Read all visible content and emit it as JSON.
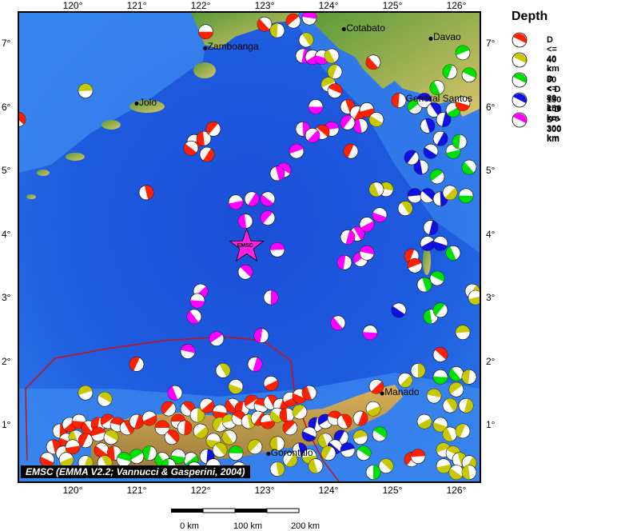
{
  "legend": {
    "title": "Depth",
    "items": [
      {
        "label": "D <= 40 km",
        "color": "#ff2000"
      },
      {
        "label": "40 < D <= 80 km",
        "color": "#c8c800"
      },
      {
        "label": "80 < D <= 150 km",
        "color": "#00e000"
      },
      {
        "label": "150 < D <= 300 km",
        "color": "#1010e0"
      },
      {
        "label": "D > 300 km",
        "color": "#ff00ff"
      }
    ]
  },
  "credit": "EMSC (EMMA V2.2; Vannucci & Gasperini, 2004)",
  "star_label": "EMSC",
  "scale": {
    "labels": [
      "0 km",
      "100 km",
      "200 km"
    ]
  },
  "axes": {
    "lon_labels": [
      "120°",
      "121°",
      "122°",
      "123°",
      "124°",
      "125°",
      "126°"
    ],
    "lat_labels": [
      "7°",
      "6°",
      "5°",
      "4°",
      "3°",
      "2°",
      "1°"
    ]
  },
  "cities": [
    {
      "name": "Zamboanga",
      "lon": 122.07,
      "lat": 6.92
    },
    {
      "name": "Cotabato",
      "lon": 124.24,
      "lat": 7.22
    },
    {
      "name": "Davao",
      "lon": 125.6,
      "lat": 7.07
    },
    {
      "name": "Jolo",
      "lon": 121.0,
      "lat": 6.05
    },
    {
      "name": "General Santos",
      "lon": 125.17,
      "lat": 6.11
    },
    {
      "name": "Manado",
      "lon": 124.84,
      "lat": 1.49
    },
    {
      "name": "Gorontalo",
      "lon": 123.06,
      "lat": 0.54
    }
  ],
  "epicenter": {
    "lon": 122.72,
    "lat": 3.8
  },
  "events": [
    {
      "lon": 122.08,
      "lat": 7.18,
      "d": 1
    },
    {
      "lon": 123.0,
      "lat": 7.3,
      "d": 1
    },
    {
      "lon": 123.2,
      "lat": 7.2,
      "d": 2
    },
    {
      "lon": 123.45,
      "lat": 7.35,
      "d": 1
    },
    {
      "lon": 123.7,
      "lat": 7.4,
      "d": 5
    },
    {
      "lon": 123.65,
      "lat": 7.05,
      "d": 2
    },
    {
      "lon": 123.6,
      "lat": 6.8,
      "d": 5
    },
    {
      "lon": 123.75,
      "lat": 6.78,
      "d": 5
    },
    {
      "lon": 123.9,
      "lat": 6.78,
      "d": 5
    },
    {
      "lon": 124.05,
      "lat": 6.8,
      "d": 2
    },
    {
      "lon": 124.1,
      "lat": 6.55,
      "d": 2
    },
    {
      "lon": 124.0,
      "lat": 6.35,
      "d": 2
    },
    {
      "lon": 124.1,
      "lat": 6.25,
      "d": 1
    },
    {
      "lon": 124.3,
      "lat": 6.0,
      "d": 1
    },
    {
      "lon": 124.45,
      "lat": 5.9,
      "d": 1
    },
    {
      "lon": 124.6,
      "lat": 5.95,
      "d": 1
    },
    {
      "lon": 124.75,
      "lat": 5.8,
      "d": 2
    },
    {
      "lon": 124.5,
      "lat": 5.7,
      "d": 5
    },
    {
      "lon": 124.3,
      "lat": 5.75,
      "d": 5
    },
    {
      "lon": 124.05,
      "lat": 5.65,
      "d": 5
    },
    {
      "lon": 123.9,
      "lat": 5.6,
      "d": 1
    },
    {
      "lon": 123.6,
      "lat": 5.65,
      "d": 5
    },
    {
      "lon": 123.75,
      "lat": 5.55,
      "d": 5
    },
    {
      "lon": 123.8,
      "lat": 6.0,
      "d": 5
    },
    {
      "lon": 124.7,
      "lat": 6.7,
      "d": 1
    },
    {
      "lon": 125.1,
      "lat": 6.1,
      "d": 1
    },
    {
      "lon": 125.35,
      "lat": 6.0,
      "d": 3
    },
    {
      "lon": 125.5,
      "lat": 6.1,
      "d": 4
    },
    {
      "lon": 125.65,
      "lat": 5.95,
      "d": 4
    },
    {
      "lon": 125.8,
      "lat": 5.8,
      "d": 4
    },
    {
      "lon": 125.95,
      "lat": 5.95,
      "d": 3
    },
    {
      "lon": 126.1,
      "lat": 6.05,
      "d": 1
    },
    {
      "lon": 125.7,
      "lat": 6.3,
      "d": 3
    },
    {
      "lon": 125.9,
      "lat": 6.55,
      "d": 3
    },
    {
      "lon": 126.1,
      "lat": 6.85,
      "d": 3
    },
    {
      "lon": 126.2,
      "lat": 6.5,
      "d": 3
    },
    {
      "lon": 125.55,
      "lat": 5.7,
      "d": 4
    },
    {
      "lon": 125.75,
      "lat": 5.5,
      "d": 4
    },
    {
      "lon": 125.95,
      "lat": 5.3,
      "d": 3
    },
    {
      "lon": 125.6,
      "lat": 5.3,
      "d": 4
    },
    {
      "lon": 125.45,
      "lat": 5.05,
      "d": 4
    },
    {
      "lon": 125.3,
      "lat": 5.2,
      "d": 4
    },
    {
      "lon": 125.35,
      "lat": 4.6,
      "d": 4
    },
    {
      "lon": 125.55,
      "lat": 4.6,
      "d": 4
    },
    {
      "lon": 125.75,
      "lat": 4.55,
      "d": 4
    },
    {
      "lon": 125.9,
      "lat": 4.65,
      "d": 2
    },
    {
      "lon": 126.15,
      "lat": 4.6,
      "d": 3
    },
    {
      "lon": 126.2,
      "lat": 5.05,
      "d": 3
    },
    {
      "lon": 126.05,
      "lat": 5.45,
      "d": 3
    },
    {
      "lon": 125.7,
      "lat": 4.9,
      "d": 3
    },
    {
      "lon": 124.9,
      "lat": 4.7,
      "d": 2
    },
    {
      "lon": 125.2,
      "lat": 4.4,
      "d": 2
    },
    {
      "lon": 125.6,
      "lat": 4.1,
      "d": 4
    },
    {
      "lon": 125.55,
      "lat": 3.85,
      "d": 4
    },
    {
      "lon": 125.75,
      "lat": 3.85,
      "d": 4
    },
    {
      "lon": 125.95,
      "lat": 3.7,
      "d": 3
    },
    {
      "lon": 125.3,
      "lat": 3.65,
      "d": 1
    },
    {
      "lon": 125.35,
      "lat": 3.5,
      "d": 1
    },
    {
      "lon": 125.7,
      "lat": 3.3,
      "d": 3
    },
    {
      "lon": 125.5,
      "lat": 3.2,
      "d": 3
    },
    {
      "lon": 126.25,
      "lat": 3.1,
      "d": 2
    },
    {
      "lon": 126.3,
      "lat": 3.0,
      "d": 2
    },
    {
      "lon": 125.1,
      "lat": 2.8,
      "d": 4
    },
    {
      "lon": 125.6,
      "lat": 2.7,
      "d": 3
    },
    {
      "lon": 125.75,
      "lat": 2.8,
      "d": 3
    },
    {
      "lon": 126.1,
      "lat": 2.45,
      "d": 2
    },
    {
      "lon": 125.75,
      "lat": 2.1,
      "d": 1
    },
    {
      "lon": 125.4,
      "lat": 1.85,
      "d": 2
    },
    {
      "lon": 125.2,
      "lat": 1.7,
      "d": 2
    },
    {
      "lon": 125.75,
      "lat": 1.75,
      "d": 3
    },
    {
      "lon": 126.0,
      "lat": 1.8,
      "d": 3
    },
    {
      "lon": 126.2,
      "lat": 1.75,
      "d": 2
    },
    {
      "lon": 126.0,
      "lat": 1.55,
      "d": 2
    },
    {
      "lon": 125.65,
      "lat": 1.45,
      "d": 2
    },
    {
      "lon": 125.9,
      "lat": 1.3,
      "d": 2
    },
    {
      "lon": 126.15,
      "lat": 1.3,
      "d": 2
    },
    {
      "lon": 125.5,
      "lat": 1.05,
      "d": 2
    },
    {
      "lon": 125.75,
      "lat": 1.0,
      "d": 2
    },
    {
      "lon": 125.9,
      "lat": 0.85,
      "d": 2
    },
    {
      "lon": 126.1,
      "lat": 0.9,
      "d": 2
    },
    {
      "lon": 125.8,
      "lat": 0.6,
      "d": 2
    },
    {
      "lon": 125.95,
      "lat": 0.55,
      "d": 2
    },
    {
      "lon": 126.05,
      "lat": 0.45,
      "d": 2
    },
    {
      "lon": 126.2,
      "lat": 0.4,
      "d": 2
    },
    {
      "lon": 125.8,
      "lat": 0.35,
      "d": 2
    },
    {
      "lon": 126.0,
      "lat": 0.25,
      "d": 2
    },
    {
      "lon": 126.2,
      "lat": 0.25,
      "d": 2
    },
    {
      "lon": 125.3,
      "lat": 0.45,
      "d": 1
    },
    {
      "lon": 125.4,
      "lat": 0.5,
      "d": 1
    },
    {
      "lon": 124.9,
      "lat": 0.35,
      "d": 2
    },
    {
      "lon": 124.7,
      "lat": 0.25,
      "d": 3
    },
    {
      "lon": 124.75,
      "lat": 1.6,
      "d": 1
    },
    {
      "lon": 124.65,
      "lat": 2.45,
      "d": 5
    },
    {
      "lon": 124.15,
      "lat": 2.6,
      "d": 5
    },
    {
      "lon": 124.25,
      "lat": 3.55,
      "d": 5
    },
    {
      "lon": 124.5,
      "lat": 3.6,
      "d": 5
    },
    {
      "lon": 124.6,
      "lat": 3.7,
      "d": 5
    },
    {
      "lon": 124.45,
      "lat": 4.0,
      "d": 5
    },
    {
      "lon": 124.3,
      "lat": 3.95,
      "d": 5
    },
    {
      "lon": 124.6,
      "lat": 4.15,
      "d": 5
    },
    {
      "lon": 124.8,
      "lat": 4.3,
      "d": 5
    },
    {
      "lon": 124.75,
      "lat": 4.7,
      "d": 2
    },
    {
      "lon": 124.35,
      "lat": 5.3,
      "d": 1
    },
    {
      "lon": 123.5,
      "lat": 5.3,
      "d": 5
    },
    {
      "lon": 123.3,
      "lat": 5.0,
      "d": 5
    },
    {
      "lon": 123.2,
      "lat": 4.95,
      "d": 5
    },
    {
      "lon": 122.8,
      "lat": 4.55,
      "d": 5
    },
    {
      "lon": 122.55,
      "lat": 4.5,
      "d": 5
    },
    {
      "lon": 123.05,
      "lat": 4.55,
      "d": 5
    },
    {
      "lon": 122.7,
      "lat": 4.2,
      "d": 5
    },
    {
      "lon": 123.05,
      "lat": 4.25,
      "d": 5
    },
    {
      "lon": 123.2,
      "lat": 3.75,
      "d": 5
    },
    {
      "lon": 122.7,
      "lat": 3.4,
      "d": 5
    },
    {
      "lon": 123.1,
      "lat": 3.0,
      "d": 5
    },
    {
      "lon": 122.0,
      "lat": 3.1,
      "d": 5
    },
    {
      "lon": 121.95,
      "lat": 2.95,
      "d": 5
    },
    {
      "lon": 121.9,
      "lat": 2.7,
      "d": 5
    },
    {
      "lon": 122.95,
      "lat": 2.4,
      "d": 5
    },
    {
      "lon": 122.25,
      "lat": 2.35,
      "d": 5
    },
    {
      "lon": 121.8,
      "lat": 2.15,
      "d": 5
    },
    {
      "lon": 122.35,
      "lat": 1.85,
      "d": 2
    },
    {
      "lon": 122.85,
      "lat": 1.95,
      "d": 5
    },
    {
      "lon": 123.1,
      "lat": 1.65,
      "d": 1
    },
    {
      "lon": 122.55,
      "lat": 1.6,
      "d": 2
    },
    {
      "lon": 121.6,
      "lat": 1.5,
      "d": 5
    },
    {
      "lon": 121.0,
      "lat": 1.95,
      "d": 1
    },
    {
      "lon": 120.2,
      "lat": 1.5,
      "d": 2
    },
    {
      "lon": 120.5,
      "lat": 1.4,
      "d": 2
    },
    {
      "lon": 121.15,
      "lat": 4.65,
      "d": 1
    },
    {
      "lon": 122.1,
      "lat": 5.25,
      "d": 1
    },
    {
      "lon": 121.9,
      "lat": 5.45,
      "d": 1
    },
    {
      "lon": 121.85,
      "lat": 5.35,
      "d": 1
    },
    {
      "lon": 122.05,
      "lat": 5.5,
      "d": 1
    },
    {
      "lon": 122.2,
      "lat": 5.65,
      "d": 1
    },
    {
      "lon": 120.2,
      "lat": 6.25,
      "d": 2
    },
    {
      "lon": 119.15,
      "lat": 5.8,
      "d": 1
    },
    {
      "lon": 119.8,
      "lat": 0.9,
      "d": 1
    },
    {
      "lon": 119.95,
      "lat": 1.0,
      "d": 1
    },
    {
      "lon": 120.1,
      "lat": 1.05,
      "d": 1
    },
    {
      "lon": 120.25,
      "lat": 0.95,
      "d": 1
    },
    {
      "lon": 120.4,
      "lat": 1.0,
      "d": 1
    },
    {
      "lon": 120.55,
      "lat": 1.05,
      "d": 1
    },
    {
      "lon": 120.7,
      "lat": 1.0,
      "d": 1
    },
    {
      "lon": 120.85,
      "lat": 0.95,
      "d": 1
    },
    {
      "lon": 121.0,
      "lat": 1.05,
      "d": 1
    },
    {
      "lon": 121.2,
      "lat": 1.1,
      "d": 1
    },
    {
      "lon": 119.9,
      "lat": 0.75,
      "d": 1
    },
    {
      "lon": 120.05,
      "lat": 0.8,
      "d": 2
    },
    {
      "lon": 120.2,
      "lat": 0.75,
      "d": 1
    },
    {
      "lon": 120.4,
      "lat": 0.85,
      "d": 1
    },
    {
      "lon": 120.6,
      "lat": 0.8,
      "d": 2
    },
    {
      "lon": 119.7,
      "lat": 0.65,
      "d": 1
    },
    {
      "lon": 119.85,
      "lat": 0.55,
      "d": 2
    },
    {
      "lon": 120.0,
      "lat": 0.65,
      "d": 1
    },
    {
      "lon": 120.45,
      "lat": 0.6,
      "d": 1
    },
    {
      "lon": 120.65,
      "lat": 0.55,
      "d": 1
    },
    {
      "lon": 121.5,
      "lat": 1.25,
      "d": 1
    },
    {
      "lon": 121.65,
      "lat": 1.05,
      "d": 1
    },
    {
      "lon": 121.8,
      "lat": 1.25,
      "d": 1
    },
    {
      "lon": 121.95,
      "lat": 1.15,
      "d": 2
    },
    {
      "lon": 122.1,
      "lat": 1.3,
      "d": 1
    },
    {
      "lon": 122.3,
      "lat": 1.2,
      "d": 1
    },
    {
      "lon": 122.5,
      "lat": 1.3,
      "d": 1
    },
    {
      "lon": 122.65,
      "lat": 1.25,
      "d": 1
    },
    {
      "lon": 122.8,
      "lat": 1.35,
      "d": 1
    },
    {
      "lon": 122.95,
      "lat": 1.3,
      "d": 1
    },
    {
      "lon": 123.1,
      "lat": 1.35,
      "d": 1
    },
    {
      "lon": 123.25,
      "lat": 1.3,
      "d": 1
    },
    {
      "lon": 123.4,
      "lat": 1.4,
      "d": 1
    },
    {
      "lon": 123.55,
      "lat": 1.45,
      "d": 1
    },
    {
      "lon": 123.7,
      "lat": 1.5,
      "d": 1
    },
    {
      "lon": 122.3,
      "lat": 1.0,
      "d": 2
    },
    {
      "lon": 122.45,
      "lat": 1.05,
      "d": 2
    },
    {
      "lon": 122.6,
      "lat": 1.1,
      "d": 1
    },
    {
      "lon": 122.75,
      "lat": 1.05,
      "d": 2
    },
    {
      "lon": 122.9,
      "lat": 1.1,
      "d": 1
    },
    {
      "lon": 123.05,
      "lat": 1.05,
      "d": 1
    },
    {
      "lon": 123.2,
      "lat": 1.15,
      "d": 2
    },
    {
      "lon": 123.35,
      "lat": 1.15,
      "d": 1
    },
    {
      "lon": 123.55,
      "lat": 1.2,
      "d": 2
    },
    {
      "lon": 121.4,
      "lat": 0.95,
      "d": 1
    },
    {
      "lon": 121.55,
      "lat": 0.8,
      "d": 1
    },
    {
      "lon": 121.75,
      "lat": 0.95,
      "d": 1
    },
    {
      "lon": 122.0,
      "lat": 0.9,
      "d": 2
    },
    {
      "lon": 122.2,
      "lat": 0.75,
      "d": 2
    },
    {
      "lon": 122.45,
      "lat": 0.8,
      "d": 2
    },
    {
      "lon": 123.8,
      "lat": 1.0,
      "d": 4
    },
    {
      "lon": 123.95,
      "lat": 1.05,
      "d": 4
    },
    {
      "lon": 124.1,
      "lat": 1.1,
      "d": 1
    },
    {
      "lon": 124.25,
      "lat": 1.05,
      "d": 1
    },
    {
      "lon": 124.5,
      "lat": 1.1,
      "d": 1
    },
    {
      "lon": 124.7,
      "lat": 1.25,
      "d": 2
    },
    {
      "lon": 123.7,
      "lat": 0.85,
      "d": 4
    },
    {
      "lon": 123.95,
      "lat": 0.75,
      "d": 2
    },
    {
      "lon": 124.2,
      "lat": 0.8,
      "d": 4
    },
    {
      "lon": 124.5,
      "lat": 0.8,
      "d": 2
    },
    {
      "lon": 124.8,
      "lat": 0.85,
      "d": 3
    },
    {
      "lon": 123.55,
      "lat": 0.6,
      "d": 4
    },
    {
      "lon": 123.4,
      "lat": 0.45,
      "d": 2
    },
    {
      "lon": 123.7,
      "lat": 0.5,
      "d": 2
    },
    {
      "lon": 124.1,
      "lat": 0.65,
      "d": 4
    },
    {
      "lon": 123.2,
      "lat": 0.7,
      "d": 2
    },
    {
      "lon": 122.85,
      "lat": 0.65,
      "d": 2
    },
    {
      "lon": 122.55,
      "lat": 0.55,
      "d": 3
    },
    {
      "lon": 122.3,
      "lat": 0.6,
      "d": 2
    },
    {
      "lon": 122.1,
      "lat": 0.5,
      "d": 4
    },
    {
      "lon": 121.85,
      "lat": 0.45,
      "d": 3
    },
    {
      "lon": 121.65,
      "lat": 0.5,
      "d": 3
    },
    {
      "lon": 121.4,
      "lat": 0.45,
      "d": 3
    },
    {
      "lon": 121.2,
      "lat": 0.55,
      "d": 3
    },
    {
      "lon": 121.0,
      "lat": 0.5,
      "d": 3
    },
    {
      "lon": 120.8,
      "lat": 0.45,
      "d": 3
    },
    {
      "lon": 120.5,
      "lat": 0.4,
      "d": 2
    },
    {
      "lon": 120.2,
      "lat": 0.4,
      "d": 2
    },
    {
      "lon": 119.9,
      "lat": 0.45,
      "d": 2
    },
    {
      "lon": 119.6,
      "lat": 0.45,
      "d": 1
    },
    {
      "lon": 123.8,
      "lat": 0.35,
      "d": 2
    },
    {
      "lon": 124.0,
      "lat": 0.55,
      "d": 2
    },
    {
      "lon": 124.3,
      "lat": 0.6,
      "d": 4
    },
    {
      "lon": 124.55,
      "lat": 0.55,
      "d": 3
    },
    {
      "lon": 123.2,
      "lat": 0.3,
      "d": 2
    },
    {
      "lon": 122.6,
      "lat": 0.3,
      "d": 2
    },
    {
      "lon": 122.2,
      "lat": 0.35,
      "d": 3
    },
    {
      "lon": 121.9,
      "lat": 0.3,
      "d": 4
    },
    {
      "lon": 121.5,
      "lat": 0.35,
      "d": 3
    },
    {
      "lon": 123.4,
      "lat": 0.95,
      "d": 1
    }
  ]
}
